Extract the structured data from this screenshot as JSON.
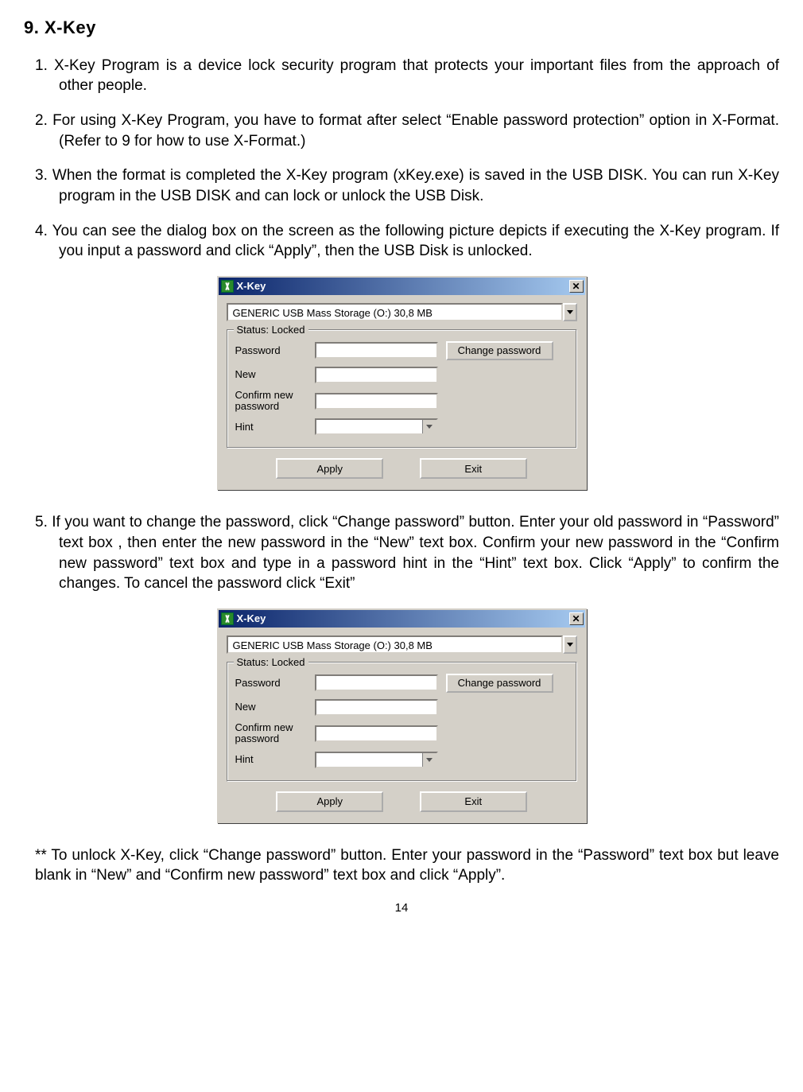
{
  "page": {
    "heading": "9. X-Key",
    "p1": "1. X-Key Program is a device lock security program that protects your important files from the approach of other people.",
    "p2": "2. For using X-Key Program, you have to format after select “Enable password protection” option in X-Format. (Refer to 9 for how to use X-Format.)",
    "p3": "3. When the format is completed the X-Key program (xKey.exe) is saved in the USB DISK. You can run X-Key program in the USB DISK and can lock or unlock the USB Disk.",
    "p4": "4. You can see the dialog box on the screen as the following picture depicts if executing the X-Key program. If you input a password and click “Apply”, then the USB Disk is unlocked.",
    "p5": "5. If you want to change the password, click “Change password” button. Enter your old password in “Password” text box , then enter the new password in the “New” text box. Confirm your new password in the “Confirm new password” text box and type in a password hint in the “Hint” text box. Click “Apply”  to confirm the changes. To cancel the password click “Exit”",
    "p6": "** To unlock X-Key, click “Change password” button. Enter your password in the “Password” text box but leave blank in “New” and “Confirm new password” text box and click “Apply”.",
    "page_number": "14"
  },
  "dialog": {
    "title": "X-Key",
    "close": "✕",
    "combo_value": "GENERIC USB Mass Storage (O:) 30,8 MB",
    "group_title": "Status: Locked",
    "labels": {
      "password": "Password",
      "new": "New",
      "confirm": "Confirm new password",
      "hint": "Hint"
    },
    "buttons": {
      "change": "Change password",
      "apply": "Apply",
      "exit": "Exit"
    }
  }
}
